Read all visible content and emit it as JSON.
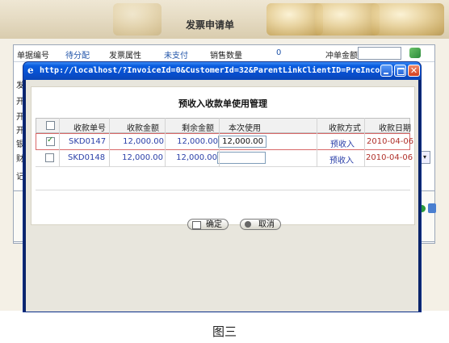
{
  "background": {
    "page_title": "发票申请单",
    "row1": {
      "no_label": "单据编号",
      "no_value": "待分配",
      "attr_label": "发票属性",
      "attr_value": "未支付",
      "qty_label": "销售数量",
      "qty_value": "0",
      "offset_label": "冲单金额"
    },
    "row2_label": "发",
    "side_labels": [
      "发",
      "开",
      "开",
      "开",
      "银",
      "财",
      "记"
    ]
  },
  "window": {
    "title": "http://localhost/?InvoiceId=0&CustomerId=32&ParentLinkClientID=PreInco...",
    "dialog_title": "预收入收款单使用管理",
    "columns": [
      "收款单号",
      "收款金额",
      "剩余金额",
      "本次使用",
      "收款方式",
      "收款日期"
    ],
    "rows": [
      {
        "checked": true,
        "no": "SKD0147",
        "amount": "12,000.00",
        "remaining": "12,000.00",
        "use": "12,000.00",
        "method": "预收入",
        "date": "2010-04-06"
      },
      {
        "checked": false,
        "no": "SKD0148",
        "amount": "12,000.00",
        "remaining": "12,000.00",
        "use": "",
        "method": "预收入",
        "date": "2010-04-06"
      }
    ],
    "buttons": {
      "ok": "确定",
      "cancel": "取消"
    }
  },
  "caption": "图三",
  "colors": {
    "titlebar": "#0a5ee0",
    "link_text": "#2a3fa8",
    "date_text": "#b0302a",
    "selected_border": "#d96868"
  }
}
